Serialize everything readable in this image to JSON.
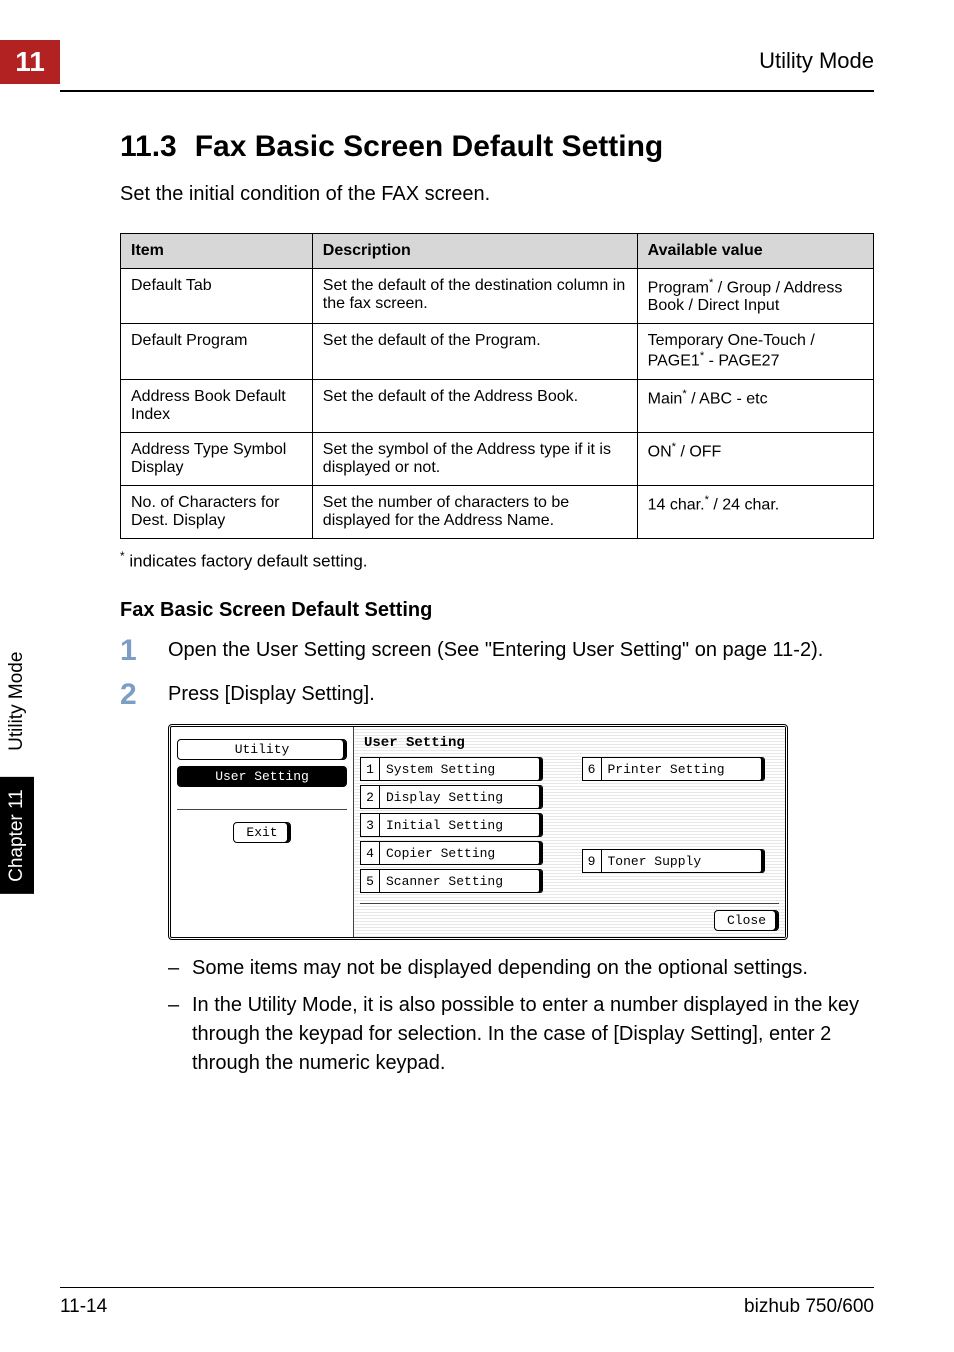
{
  "chapter_tab": "11",
  "header_right": "Utility Mode",
  "side_tab": {
    "black": "Chapter 11",
    "gray": "Utility Mode"
  },
  "h2": {
    "num": "11.3",
    "title": "Fax Basic Screen Default Setting"
  },
  "intro": "Set the initial condition of the FAX screen.",
  "table": {
    "headers": [
      "Item",
      "Description",
      "Available value"
    ],
    "rows": [
      {
        "item": "Default Tab",
        "desc": "Set the default of the destination column in the fax screen.",
        "val_pre": "Program",
        "val_post": " / Group / Address Book / Direct Input",
        "has_sup": true
      },
      {
        "item": "Default Program",
        "desc": "Set the default of the Program.",
        "val_pre": "Temporary One-Touch / PAGE1",
        "val_post": " - PAGE27",
        "has_sup": true
      },
      {
        "item": "Address Book Default Index",
        "desc": "Set the default of the Address Book.",
        "val_pre": "Main",
        "val_post": " / ABC - etc",
        "has_sup": true
      },
      {
        "item": "Address Type Symbol Display",
        "desc": "Set the symbol of the Address type if it is displayed or not.",
        "val_pre": "ON",
        "val_post": " / OFF",
        "has_sup": true
      },
      {
        "item": "No. of Characters for Dest. Display",
        "desc": "Set the number of characters to be displayed for the Address Name.",
        "val_pre": "14 char.",
        "val_post": " / 24 char.",
        "has_sup": true
      }
    ]
  },
  "footnote": " indicates factory default setting.",
  "subhead": "Fax Basic Screen Default Setting",
  "steps": [
    {
      "num": "1",
      "text": "Open the User Setting screen (See \"Entering User Setting\" on page 11-2)."
    },
    {
      "num": "2",
      "text": "Press [Display Setting]."
    }
  ],
  "ui": {
    "left_tab_utility": "Utility",
    "left_tab_user_setting": "User Setting",
    "left_exit": "Exit",
    "right_title": "User Setting",
    "buttons_left": [
      {
        "n": "1",
        "l": "System Setting"
      },
      {
        "n": "2",
        "l": "Display Setting"
      },
      {
        "n": "3",
        "l": "Initial Setting"
      },
      {
        "n": "4",
        "l": "Copier Setting"
      },
      {
        "n": "5",
        "l": "Scanner Setting"
      }
    ],
    "buttons_right": [
      {
        "n": "6",
        "l": "Printer Setting"
      },
      {
        "n": "9",
        "l": "Toner Supply"
      }
    ],
    "close": "Close"
  },
  "dashes": [
    "Some items may not be displayed depending on the optional settings.",
    "In the Utility Mode, it is also possible to enter a number displayed in the key through the keypad for selection. In the case of [Display Setting], enter 2 through the numeric keypad."
  ],
  "footer": {
    "left": "11-14",
    "right": "bizhub 750/600"
  }
}
